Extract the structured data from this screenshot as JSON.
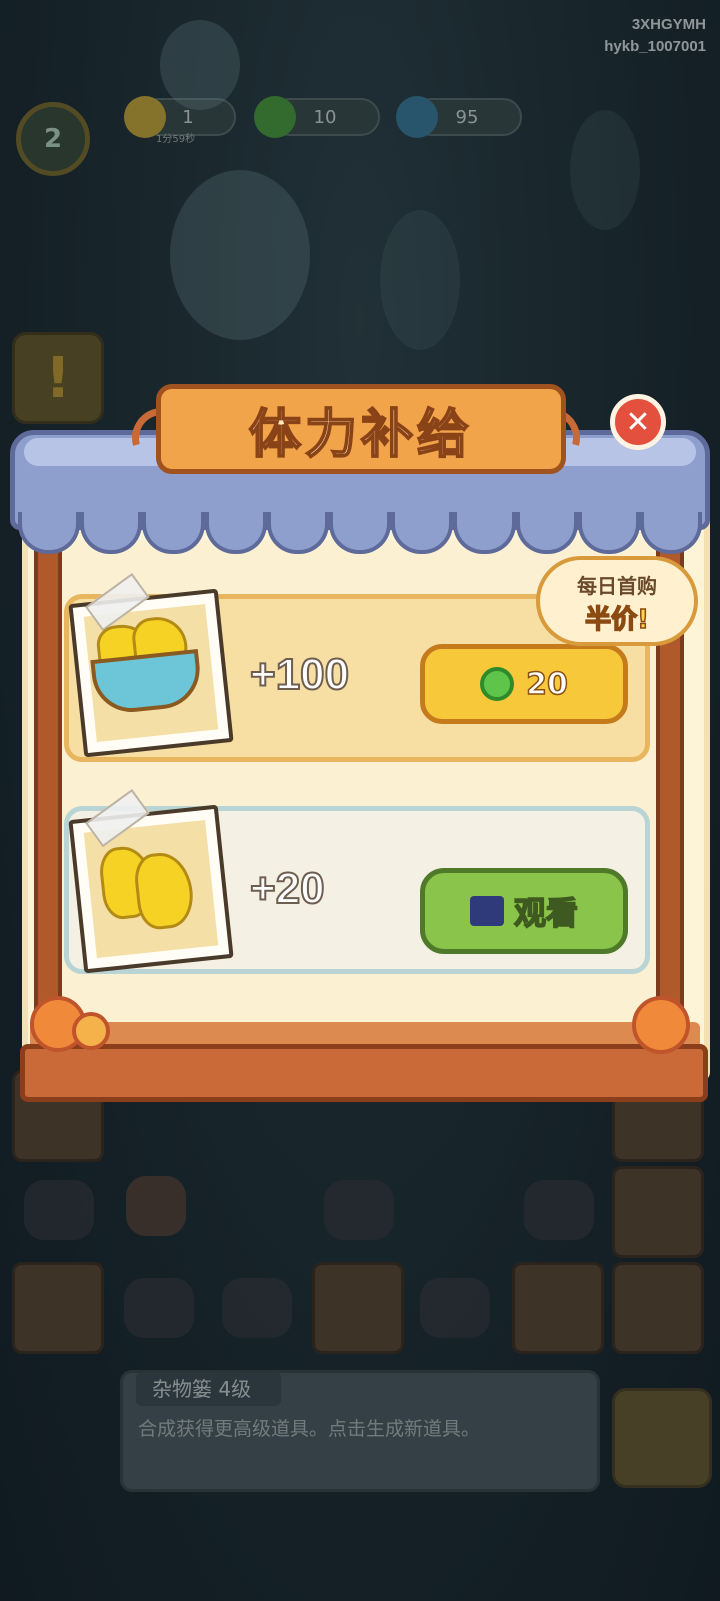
{
  "header": {
    "user_code": "3XHGYMH",
    "user_id": "hykb_1007001",
    "level": "2",
    "resources": [
      {
        "icon": "energy-bolt-icon",
        "value": "1",
        "timer": "1分59秒"
      },
      {
        "icon": "green-gem-icon",
        "value": "10"
      },
      {
        "icon": "blue-flame-icon",
        "value": "95"
      }
    ]
  },
  "shop": {
    "title": "体力补给",
    "close_icon": "close-icon",
    "offers": [
      {
        "amount": "+100",
        "price": "20",
        "currency_icon": "green-gem-icon",
        "badge_line1": "每日首购",
        "badge_line2": "半价!"
      },
      {
        "amount": "+20",
        "action_label": "观看",
        "action_icon": "video-clapper-icon"
      }
    ]
  },
  "info_panel": {
    "title": "杂物篓  4级",
    "description": "合成获得更高级道具。点击生成新道具。"
  },
  "colors": {
    "gold_button": "#f7c83a",
    "green_button": "#8ac44a",
    "awning": "#8e9fcd",
    "close": "#e4503e"
  }
}
